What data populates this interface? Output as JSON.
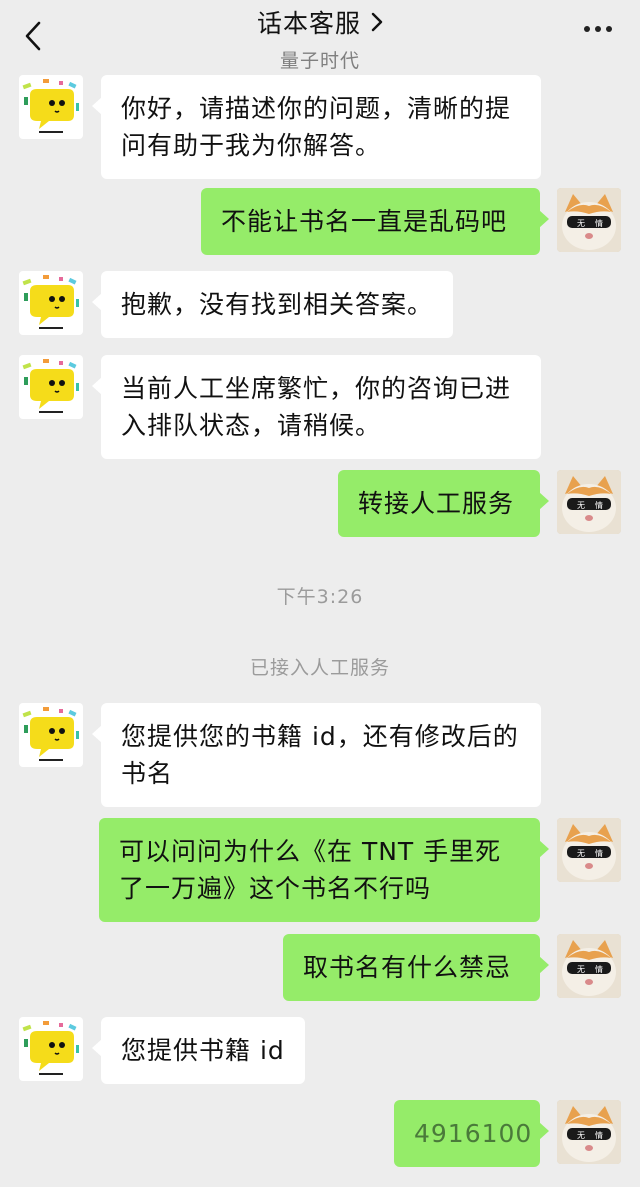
{
  "header": {
    "title": "话本客服",
    "subtitle": "量子时代"
  },
  "messages": [
    {
      "side": "left",
      "text": "你好，请描述你的问题，清晰的提问有助于我为你解答。"
    },
    {
      "side": "right",
      "text": "不能让书名一直是乱码吧"
    },
    {
      "side": "left",
      "text": "抱歉，没有找到相关答案。"
    },
    {
      "side": "left",
      "text": "当前人工坐席繁忙，你的咨询已进入排队状态，请稍候。"
    },
    {
      "side": "right",
      "text": "转接人工服务"
    },
    {
      "side": "left",
      "text": "您提供您的书籍 id，还有修改后的书名"
    },
    {
      "side": "right",
      "text": "可以问问为什么《在 TNT 手里死了一万遍》这个书名不行吗"
    },
    {
      "side": "right",
      "text": "取书名有什么禁忌"
    },
    {
      "side": "left",
      "text": "您提供书籍 id"
    },
    {
      "side": "right",
      "text": "4916100"
    }
  ],
  "system": {
    "time": "下午3:26",
    "connected": "已接入人工服务"
  },
  "avatar": {
    "user_glasses_text_1": "无",
    "user_glasses_text_2": "情"
  },
  "colors": {
    "background": "#ededed",
    "bubble_self": "#95ec69",
    "bubble_other": "#ffffff",
    "bot_face": "#f5dc1a"
  }
}
